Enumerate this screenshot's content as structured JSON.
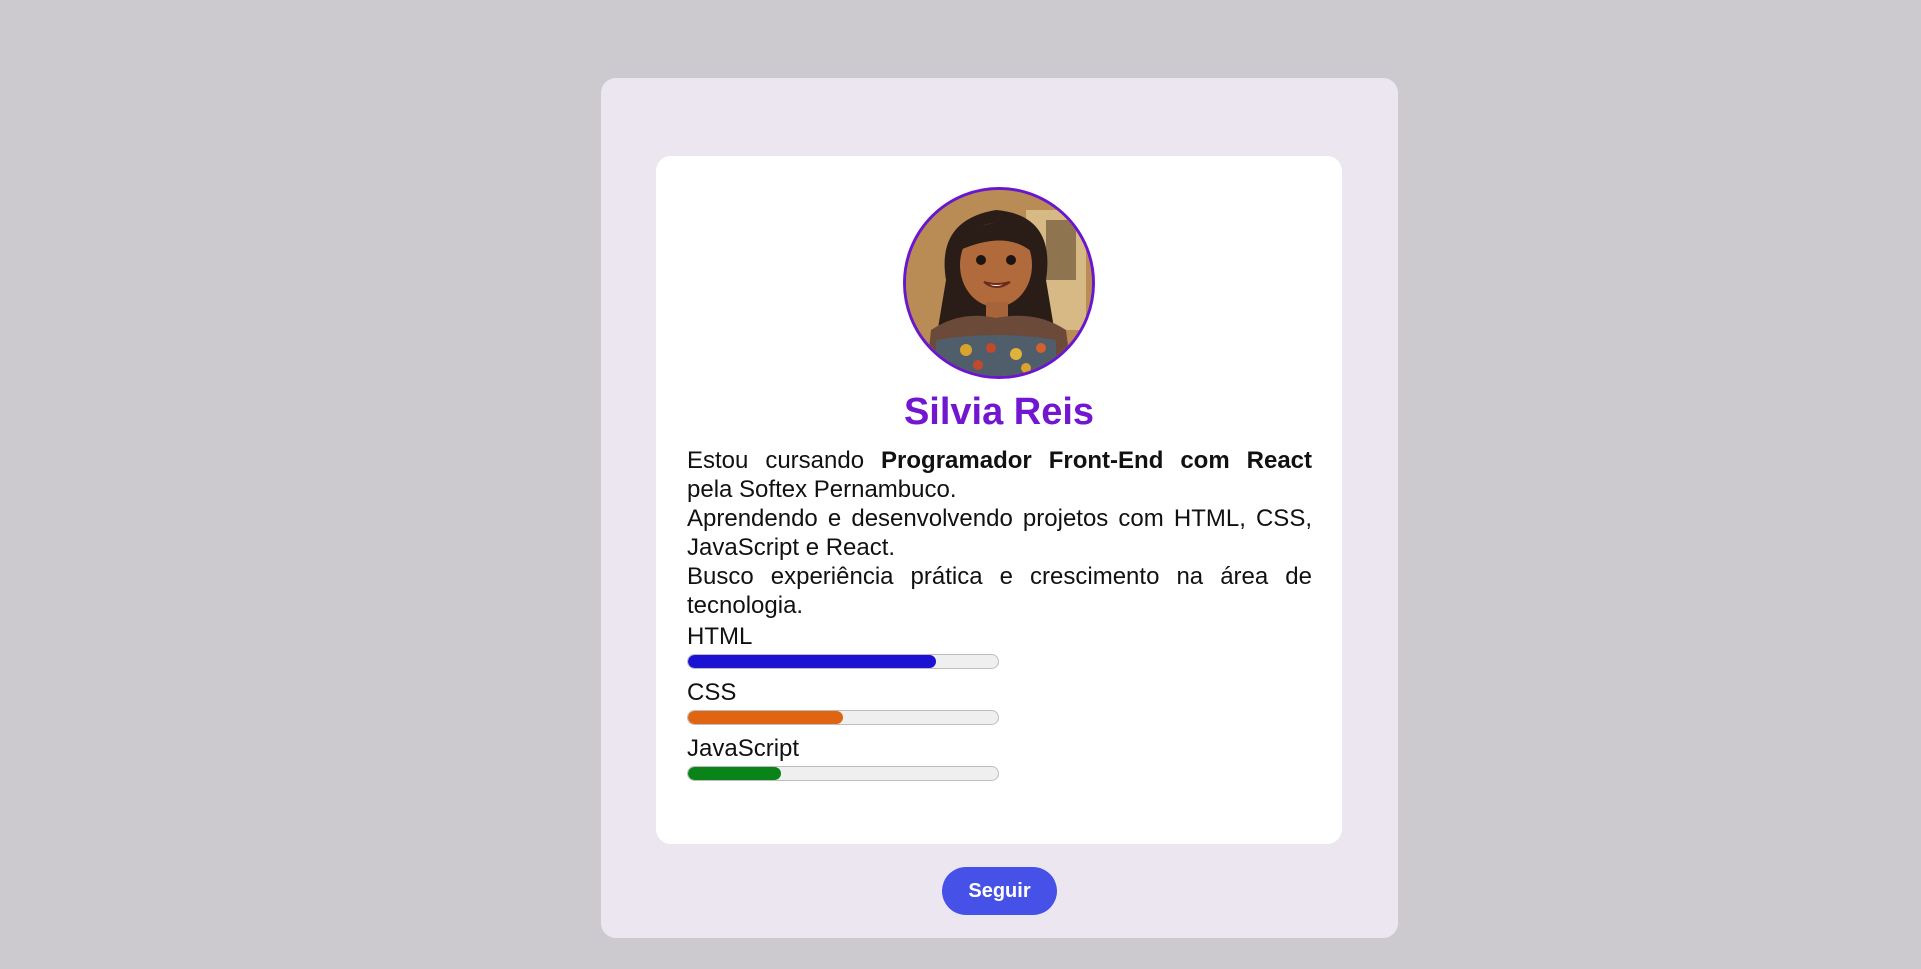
{
  "profile": {
    "name": "Silvia Reis",
    "avatar_alt": "Silvia Reis",
    "bio": {
      "p1_start": "Estou cursando ",
      "p1_bold": "Programador Front-End com React",
      "p1_end": " pela Softex Pernambuco.",
      "p2": "Aprendendo e desenvolvendo projetos com HTML, CSS, JavaScript e React.",
      "p3": "Busco experiência prática e crescimento na área de tecnologia."
    }
  },
  "skills": [
    {
      "label": "HTML",
      "level": 0.8,
      "color": "#1c12d1"
    },
    {
      "label": "CSS",
      "level": 0.5,
      "color": "#df6512"
    },
    {
      "label": "JavaScript",
      "level": 0.3,
      "color": "#0a8418"
    }
  ],
  "actions": {
    "follow_label": "Seguir"
  },
  "colors": {
    "background": "#cccacf",
    "outer_card": "#ece6f1",
    "accent": "#7316cf",
    "button": "#4651e8"
  }
}
